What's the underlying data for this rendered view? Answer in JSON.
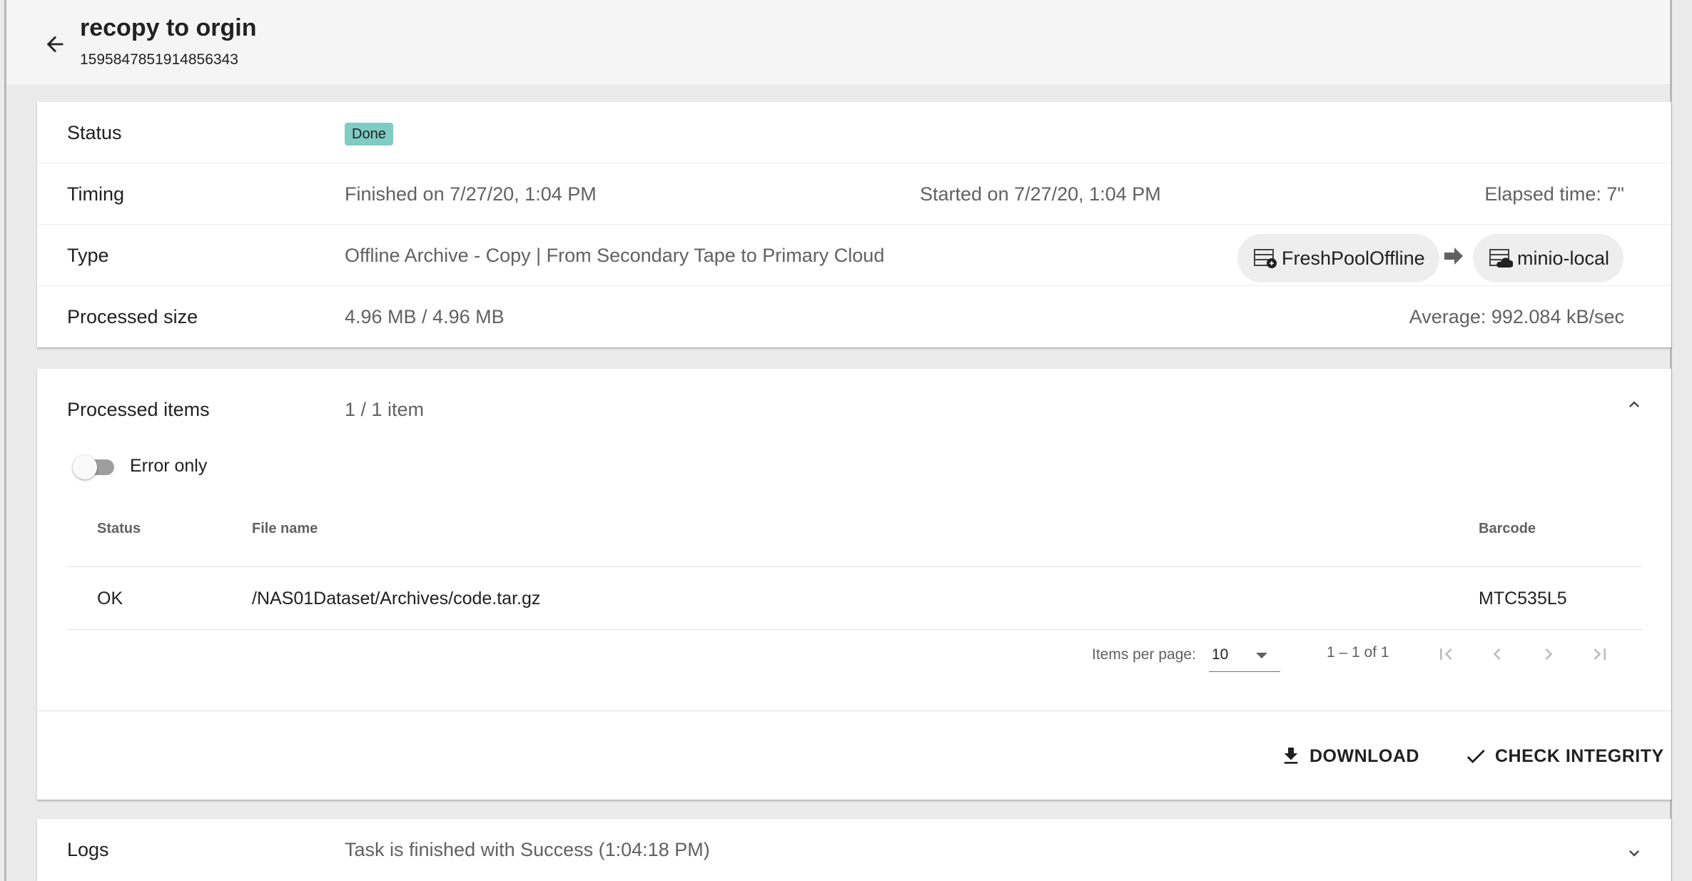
{
  "header": {
    "title": "recopy to orgin",
    "subtitle": "1595847851914856343",
    "back_icon": "arrow-left-icon"
  },
  "summary": {
    "status": {
      "label": "Status",
      "badge": "Done",
      "badge_color": "#80cbc4"
    },
    "timing": {
      "label": "Timing",
      "finished": "Finished on 7/27/20, 1:04 PM",
      "started": "Started on 7/27/20, 1:04 PM",
      "elapsed": "Elapsed time: 7\""
    },
    "type": {
      "label": "Type",
      "value": "Offline Archive - Copy | From Secondary Tape to Primary Cloud",
      "source_pool": "FreshPoolOffline",
      "source_icon": "tape-pool-icon",
      "destination_pool": "minio-local",
      "destination_icon": "cloud-pool-icon"
    },
    "processed_size": {
      "label": "Processed size",
      "value": "4.96 MB / 4.96 MB",
      "average": "Average: 992.084 kB/sec"
    }
  },
  "processed_items": {
    "label": "Processed items",
    "value": "1 / 1 item",
    "toggle_label": "Error only",
    "toggle_on": false,
    "columns": {
      "status": "Status",
      "file_name": "File name",
      "barcode": "Barcode"
    },
    "rows": [
      {
        "status": "OK",
        "file_name": "/NAS01Dataset/Archives/code.tar.gz",
        "barcode": "MTC535L5"
      }
    ],
    "paginator": {
      "items_per_page_label": "Items per page:",
      "items_per_page": "10",
      "range": "1 – 1 of 1"
    },
    "actions": {
      "download": "DOWNLOAD",
      "check_integrity": "CHECK INTEGRITY"
    }
  },
  "logs": {
    "label": "Logs",
    "value": "Task is finished with Success (1:04:18 PM)"
  }
}
